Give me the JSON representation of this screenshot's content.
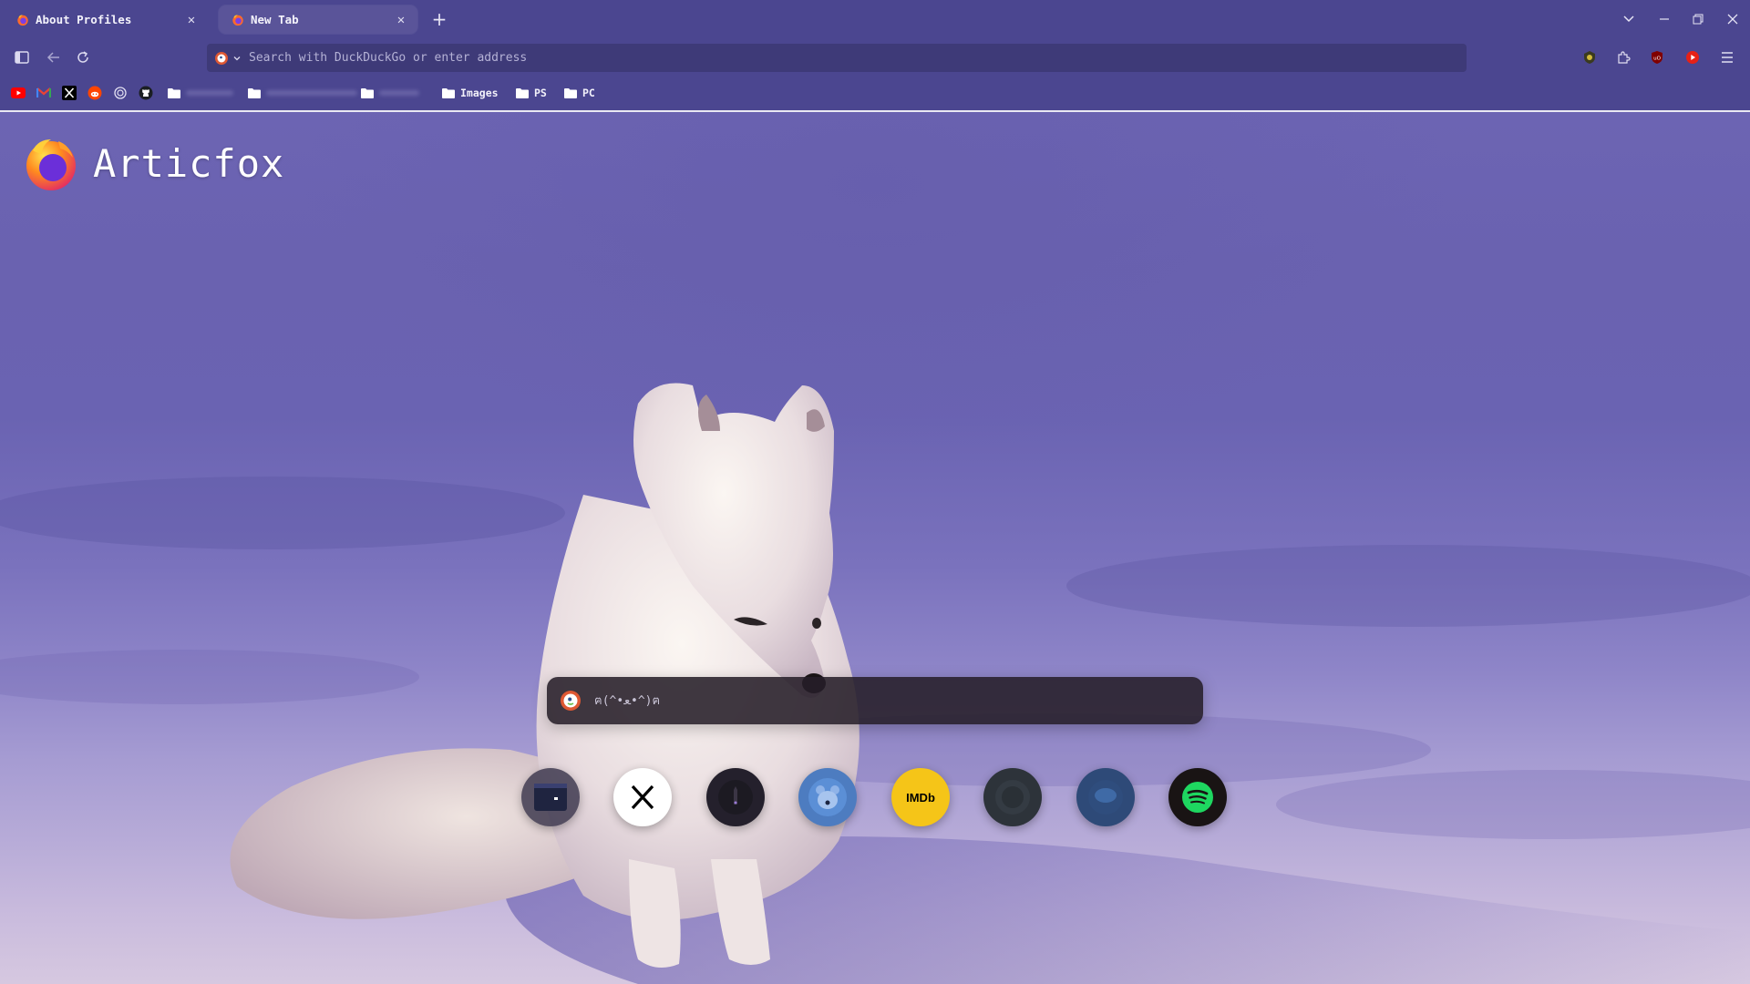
{
  "tabs": [
    {
      "label": "About Profiles",
      "active": false
    },
    {
      "label": "New Tab",
      "active": true
    }
  ],
  "urlbar": {
    "placeholder": "Search with DuckDuckGo or enter address"
  },
  "bookmarks": {
    "folders": [
      {
        "label": "Images"
      },
      {
        "label": "PS"
      },
      {
        "label": "PC"
      }
    ]
  },
  "brand": {
    "title": "Articfox"
  },
  "search": {
    "placeholder": "ฅ(^•ﻌ•^)ฅ"
  },
  "shortcuts": [
    {
      "name": "terminal-app",
      "icon": "terminal-icon"
    },
    {
      "name": "x",
      "icon": "x-icon"
    },
    {
      "name": "dark-site",
      "icon": "figure-icon"
    },
    {
      "name": "blue-app",
      "icon": "bear-icon"
    },
    {
      "name": "imdb",
      "icon": "imdb-icon",
      "label": "IMDb"
    },
    {
      "name": "site-6",
      "icon": "dark-globe-icon"
    },
    {
      "name": "site-7",
      "icon": "blue-globe-icon"
    },
    {
      "name": "spotify",
      "icon": "spotify-icon"
    }
  ],
  "colors": {
    "chrome": "#4b4690",
    "urlbar": "#3e3a78",
    "accent_imdb": "#f5c518",
    "accent_spotify": "#1ed760"
  }
}
